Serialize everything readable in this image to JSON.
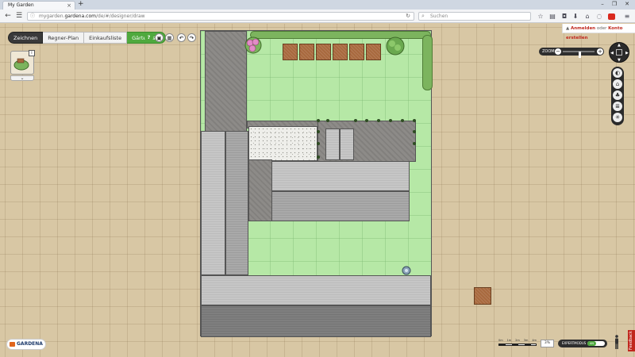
{
  "browser": {
    "tab_title": "My Garden",
    "tab_close": "×",
    "new_tab": "+",
    "url_prefix": "mygarden.",
    "url_domain": "gardena.com",
    "url_suffix": "/de/#/designer/draw",
    "search_placeholder": "Suchen",
    "window_controls": [
      "–",
      "❐",
      "✕"
    ]
  },
  "account": {
    "login": "Anmelden",
    "or": " oder ",
    "create": "Konto erstellen"
  },
  "toolbar": {
    "tabs": [
      "Zeichnen",
      "Regner-Plan",
      "Einkaufsliste",
      "Gärtenliste"
    ],
    "help": "?",
    "undo": "↶",
    "redo": "↷"
  },
  "thumbnail": {
    "badge": "i",
    "expand": "⌄"
  },
  "zoom": {
    "label": "ZOOM",
    "minus": "−",
    "plus": "+",
    "level": 0.55
  },
  "bottom": {
    "logo": "GARDENA",
    "feedback": "Feedback",
    "scale_labels": [
      "0m",
      "1m",
      "2m",
      "3m",
      "4m"
    ],
    "zoom_value": "3%",
    "expert_label": "EXPERTMODUS",
    "expert_state": "AN"
  },
  "colors": {
    "lawn": "#b6e8a6",
    "paving": "#8d8b88",
    "wood": "#a8693e",
    "brand_green": "#4fa93e",
    "brand_red": "#c0271d"
  },
  "icons": {
    "side_tools": [
      "view-icon",
      "house-icon",
      "plant-icon",
      "layers-icon",
      "sprinkler-icon"
    ]
  }
}
